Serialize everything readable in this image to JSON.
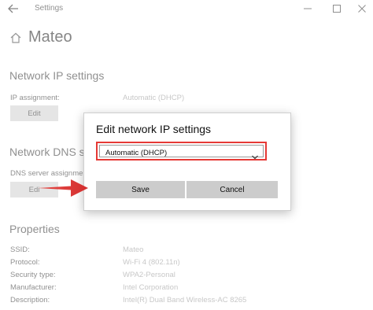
{
  "window": {
    "title": "Settings",
    "controls": {
      "minimize": "minimize-icon",
      "maximize": "maximize-icon",
      "close": "close-icon"
    }
  },
  "header": {
    "title": "Mateo"
  },
  "ip_section": {
    "title": "Network IP settings",
    "assignment_label": "IP assignment:",
    "assignment_value": "Automatic (DHCP)",
    "edit_label": "Edit"
  },
  "dns_section": {
    "title": "Network DNS se",
    "assignment_label": "DNS server assignme",
    "edit_label": "Edi"
  },
  "properties": {
    "title": "Properties",
    "rows": [
      {
        "label": "SSID:",
        "value": "Mateo"
      },
      {
        "label": "Protocol:",
        "value": "Wi-Fi 4 (802.11n)"
      },
      {
        "label": "Security type:",
        "value": "WPA2-Personal"
      },
      {
        "label": "Manufacturer:",
        "value": "Intel Corporation"
      },
      {
        "label": "Description:",
        "value": "Intel(R) Dual Band Wireless-AC 8265"
      }
    ]
  },
  "dialog": {
    "title": "Edit network IP settings",
    "selected_option": "Automatic (DHCP)",
    "save_label": "Save",
    "cancel_label": "Cancel",
    "highlight_color": "#e53935"
  },
  "annotation": {
    "arrow_color": "#e53935"
  }
}
